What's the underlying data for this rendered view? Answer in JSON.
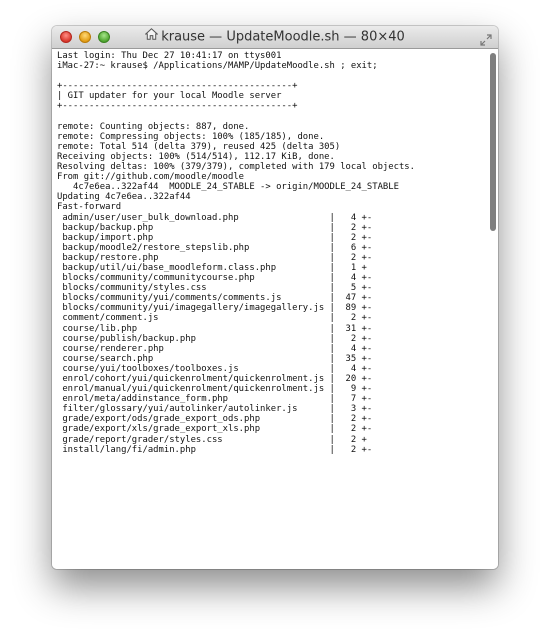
{
  "window": {
    "title": "krause — UpdateMoodle.sh — 80×40"
  },
  "terminal": {
    "lines": [
      "Last login: Thu Dec 27 10:41:17 on ttys001",
      "iMac-27:~ krause$ /Applications/MAMP/UpdateMoodle.sh ; exit;",
      "",
      "+-------------------------------------------+",
      "| GIT updater for your local Moodle server",
      "+-------------------------------------------+",
      "",
      "remote: Counting objects: 887, done.",
      "remote: Compressing objects: 100% (185/185), done.",
      "remote: Total 514 (delta 379), reused 425 (delta 305)",
      "Receiving objects: 100% (514/514), 112.17 KiB, done.",
      "Resolving deltas: 100% (379/379), completed with 179 local objects.",
      "From git://github.com/moodle/moodle",
      "   4c7e6ea..322af44  MOODLE_24_STABLE -> origin/MOODLE_24_STABLE",
      "Updating 4c7e6ea..322af44",
      "Fast-forward",
      " admin/user/user_bulk_download.php                 |   4 +-",
      " backup/backup.php                                 |   2 +-",
      " backup/import.php                                 |   2 +-",
      " backup/moodle2/restore_stepslib.php               |   6 +-",
      " backup/restore.php                                |   2 +-",
      " backup/util/ui/base_moodleform.class.php          |   1 +",
      " blocks/community/communitycourse.php              |   4 +-",
      " blocks/community/styles.css                       |   5 +-",
      " blocks/community/yui/comments/comments.js         |  47 +-",
      " blocks/community/yui/imagegallery/imagegallery.js |  89 +-",
      " comment/comment.js                                |   2 +-",
      " course/lib.php                                    |  31 +-",
      " course/publish/backup.php                         |   2 +-",
      " course/renderer.php                               |   4 +-",
      " course/search.php                                 |  35 +-",
      " course/yui/toolboxes/toolboxes.js                 |   4 +-",
      " enrol/cohort/yui/quickenrolment/quickenrolment.js |  20 +-",
      " enrol/manual/yui/quickenrolment/quickenrolment.js |   9 +-",
      " enrol/meta/addinstance_form.php                   |   7 +-",
      " filter/glossary/yui/autolinker/autolinker.js      |   3 +-",
      " grade/export/ods/grade_export_ods.php             |   2 +-",
      " grade/export/xls/grade_export_xls.php             |   2 +-",
      " grade/report/grader/styles.css                    |   2 +",
      " install/lang/fi/admin.php                         |   2 +-"
    ]
  }
}
